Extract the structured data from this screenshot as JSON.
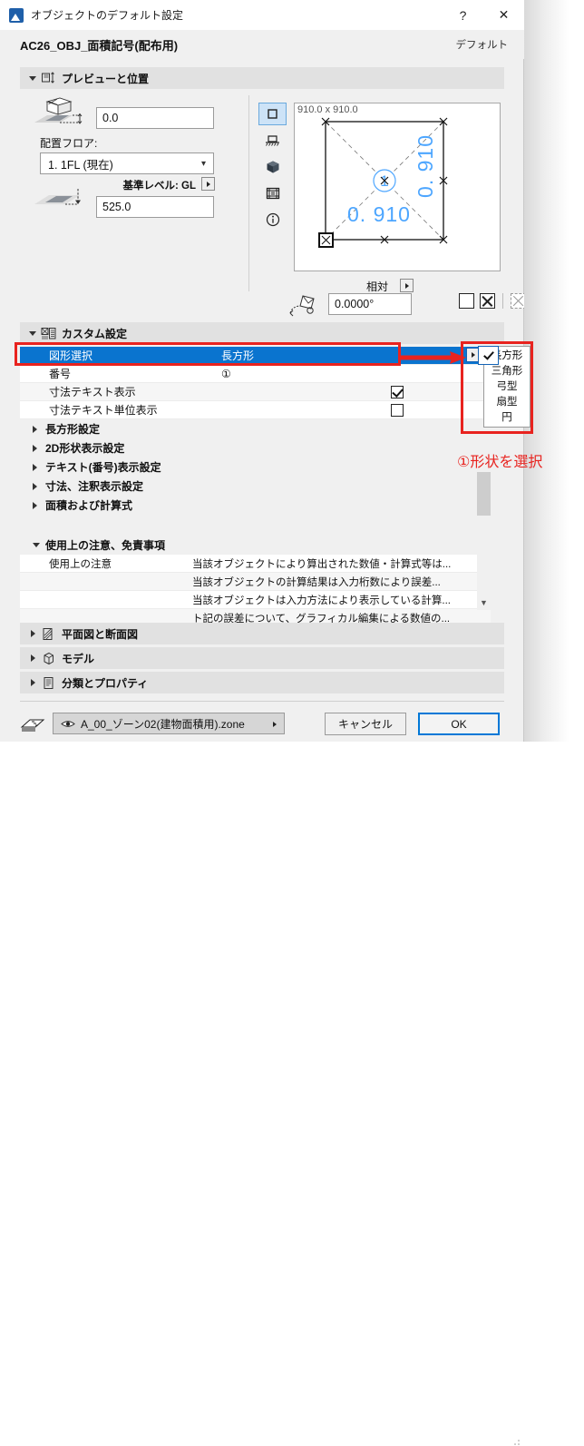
{
  "window": {
    "title": "オブジェクトのデフォルト設定",
    "app_icon": "archicad-object-icon",
    "help_button": "?",
    "close_button": "✕"
  },
  "object": {
    "name": "AC26_OBJ_面積記号(配布用)",
    "preset": "デフォルト"
  },
  "preview_section": {
    "title": "プレビューと位置",
    "icon": "preview-position-icon",
    "height_value": "0.0",
    "floor_label": "配置フロア:",
    "floor_value": "1. 1FL (現在)",
    "base_level_label": "基準レベル: GL",
    "base_value": "525.0",
    "rail": [
      {
        "name": "2d-symbol-view-icon",
        "selected": true
      },
      {
        "name": "elevation-view-icon",
        "selected": false
      },
      {
        "name": "3d-view-icon",
        "selected": false
      },
      {
        "name": "list-view-icon",
        "selected": false
      },
      {
        "name": "info-view-icon",
        "selected": false
      }
    ],
    "preview": {
      "dimensions_label": "910.0 x 910.0",
      "marker_number": "①",
      "dim_horizontal": "0. 910",
      "dim_vertical": "0. 910"
    },
    "relative_label": "相対",
    "rotation_value": "0.0000°"
  },
  "custom_section": {
    "title": "カスタム設定",
    "icon": "custom-settings-icon",
    "rows": [
      {
        "label": "図形選択",
        "value": "長方形",
        "selected": true
      },
      {
        "label": "番号",
        "value": "①",
        "selected": false
      },
      {
        "label": "寸法テキスト表示",
        "checkbox": true
      },
      {
        "label": "寸法テキスト単位表示",
        "checkbox": false
      }
    ],
    "tree_items": [
      "長方形設定",
      "2D形状表示設定",
      "テキスト(番号)表示設定",
      "寸法、注釈表示設定",
      "面積および計算式"
    ],
    "notes_title": "使用上の注意、免責事項",
    "notes_label": "使用上の注意",
    "notes": [
      "当該オブジェクトにより算出された数値・計算式等は...",
      "当該オブジェクトの計算結果は入力桁数により誤差...",
      "当該オブジェクトは入力方法により表示している計算...",
      "ト記の誤差について、グラフィカル編集による数値の..."
    ]
  },
  "dropdown": {
    "options": [
      "長方形",
      "三角形",
      "弓型",
      "扇型",
      "円"
    ],
    "selected": "長方形"
  },
  "annotation": {
    "text": "①形状を選択",
    "color": "#e8231f"
  },
  "sections": [
    {
      "label": "平面図と断面図",
      "icon": "plan-section-icon"
    },
    {
      "label": "モデル",
      "icon": "model-cube-icon"
    },
    {
      "label": "分類とプロパティ",
      "icon": "classification-icon"
    }
  ],
  "footer": {
    "layer_icon": "layers-stack-icon",
    "layer_value": "A_00_ゾーン02(建物面積用).zone",
    "cancel_label": "キャンセル",
    "ok_label": "OK"
  },
  "colors": {
    "accent": "#0a74cf",
    "ok_border": "#0078d7",
    "annotation": "#e8231f",
    "preview_dim": "#4da6ff"
  }
}
